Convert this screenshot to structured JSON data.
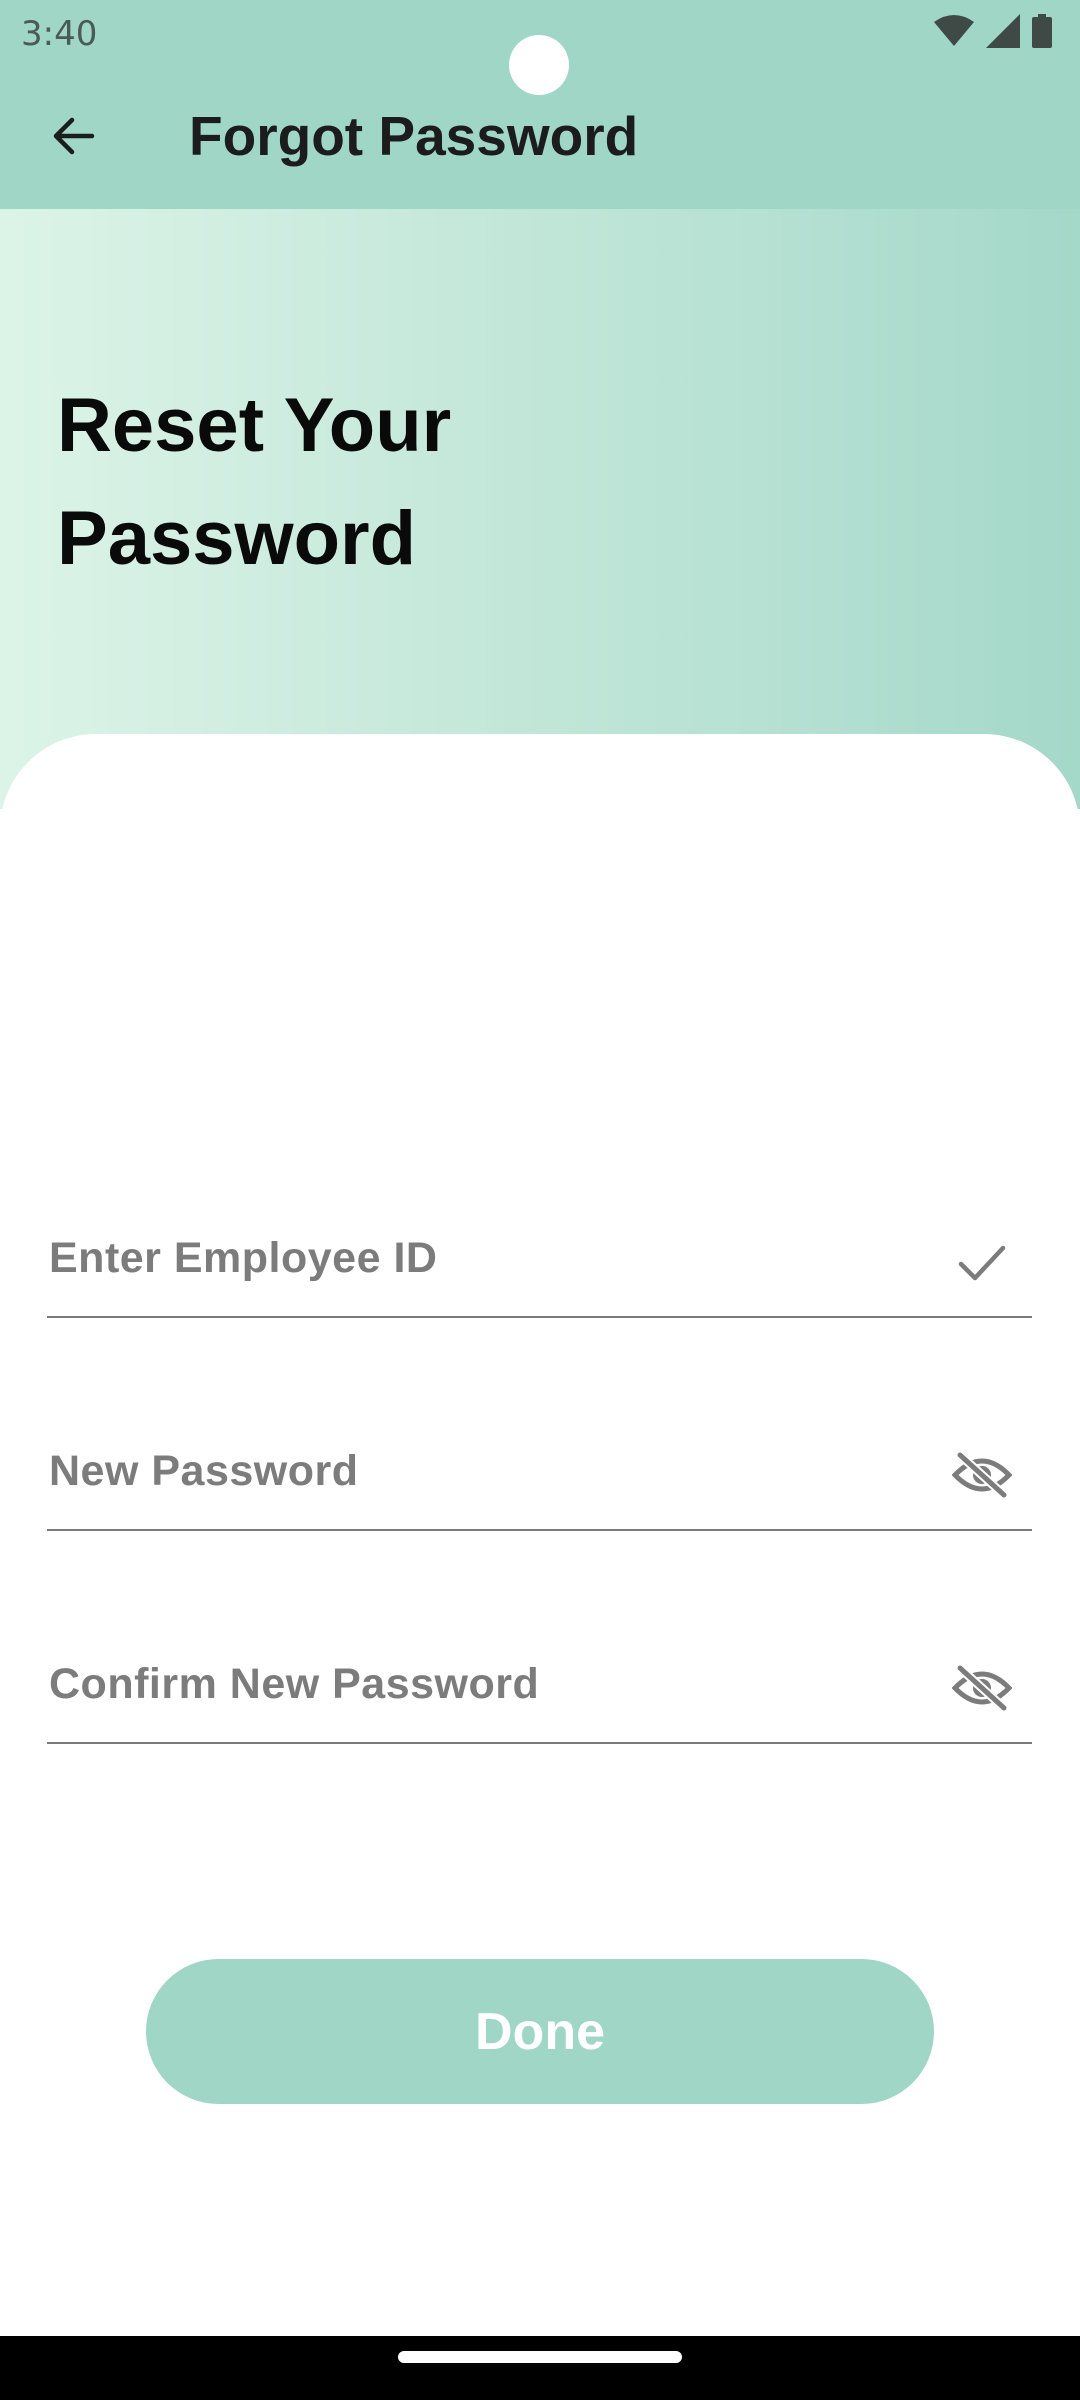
{
  "status_bar": {
    "time": "3:40",
    "icons": [
      "wifi-icon",
      "signal-icon",
      "battery-icon"
    ]
  },
  "app_bar": {
    "back_icon": "arrow-left-icon",
    "title": "Forgot Password"
  },
  "hero": {
    "title": "Reset Your Password"
  },
  "form": {
    "employee_id": {
      "placeholder": "Enter Employee ID",
      "value": "",
      "icon": "check-icon"
    },
    "new_password": {
      "placeholder": "New Password",
      "value": "",
      "icon": "eye-off-icon"
    },
    "confirm_password": {
      "placeholder": "Confirm New Password",
      "value": "",
      "icon": "eye-off-icon"
    },
    "submit_label": "Done"
  },
  "colors": {
    "accent": "#9fd6c6",
    "hero_gradient_start": "#dcf4e8",
    "hero_gradient_end": "#a4d8c9",
    "field_text": "#7c7c7c",
    "button_text": "#ffffff"
  }
}
